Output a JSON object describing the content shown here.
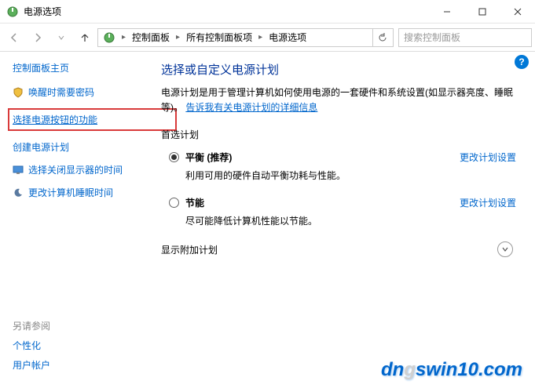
{
  "titlebar": {
    "title": "电源选项"
  },
  "nav": {
    "breadcrumb": [
      "控制面板",
      "所有控制面板项",
      "电源选项"
    ],
    "search_placeholder": "搜索控制面板"
  },
  "sidebar": {
    "home": "控制面板主页",
    "items": [
      {
        "label": "唤醒时需要密码"
      },
      {
        "label": "选择电源按钮的功能"
      },
      {
        "label": "创建电源计划"
      },
      {
        "label": "选择关闭显示器的时间"
      },
      {
        "label": "更改计算机睡眠时间"
      }
    ]
  },
  "main": {
    "title": "选择或自定义电源计划",
    "desc_prefix": "电源计划是用于管理计算机如何使用电源的一套硬件和系统设置(如显示器亮度、睡眠等)。",
    "desc_link": "告诉我有关电源计划的详细信息",
    "preferred_label": "首选计划",
    "plans": [
      {
        "name": "平衡 (推荐)",
        "desc": "利用可用的硬件自动平衡功耗与性能。",
        "link": "更改计划设置",
        "selected": true
      },
      {
        "name": "节能",
        "desc": "尽可能降低计算机性能以节能。",
        "link": "更改计划设置",
        "selected": false
      }
    ],
    "extra_label": "显示附加计划"
  },
  "footer": {
    "label": "另请参阅",
    "items": [
      "个性化",
      "用户帐户"
    ]
  },
  "watermark": {
    "pre": "dn",
    "g": "g",
    "post": "swin10.com"
  }
}
